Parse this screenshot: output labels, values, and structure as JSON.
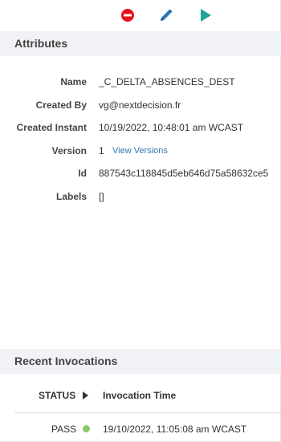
{
  "toolbar": {
    "stop_icon": "stop-icon",
    "edit_icon": "pencil-icon",
    "run_icon": "play-icon"
  },
  "attributes": {
    "title": "Attributes",
    "rows": [
      {
        "label": "Name",
        "value": "_C_DELTA_ABSENCES_DEST"
      },
      {
        "label": "Created By",
        "value": "vg@nextdecision.fr"
      },
      {
        "label": "Created Instant",
        "value": "10/19/2022, 10:48:01 am WCAST"
      },
      {
        "label": "Version",
        "value": "1"
      },
      {
        "label": "Id",
        "value": "887543c118845d5eb646d75a58632ce5"
      },
      {
        "label": "Labels",
        "value": "[]"
      }
    ],
    "view_versions_link": "View Versions"
  },
  "invocations": {
    "title": "Recent Invocations",
    "columns": {
      "status": "STATUS",
      "time": "Invocation Time"
    },
    "rows": [
      {
        "status": "PASS",
        "time": "19/10/2022, 11:05:08 am WCAST"
      }
    ]
  },
  "colors": {
    "stop": "#e8101a",
    "edit": "#2d77b6",
    "run": "#1fa398",
    "pass": "#8fc768",
    "header_bg": "#f0f2f5",
    "link": "#2d77b6"
  }
}
